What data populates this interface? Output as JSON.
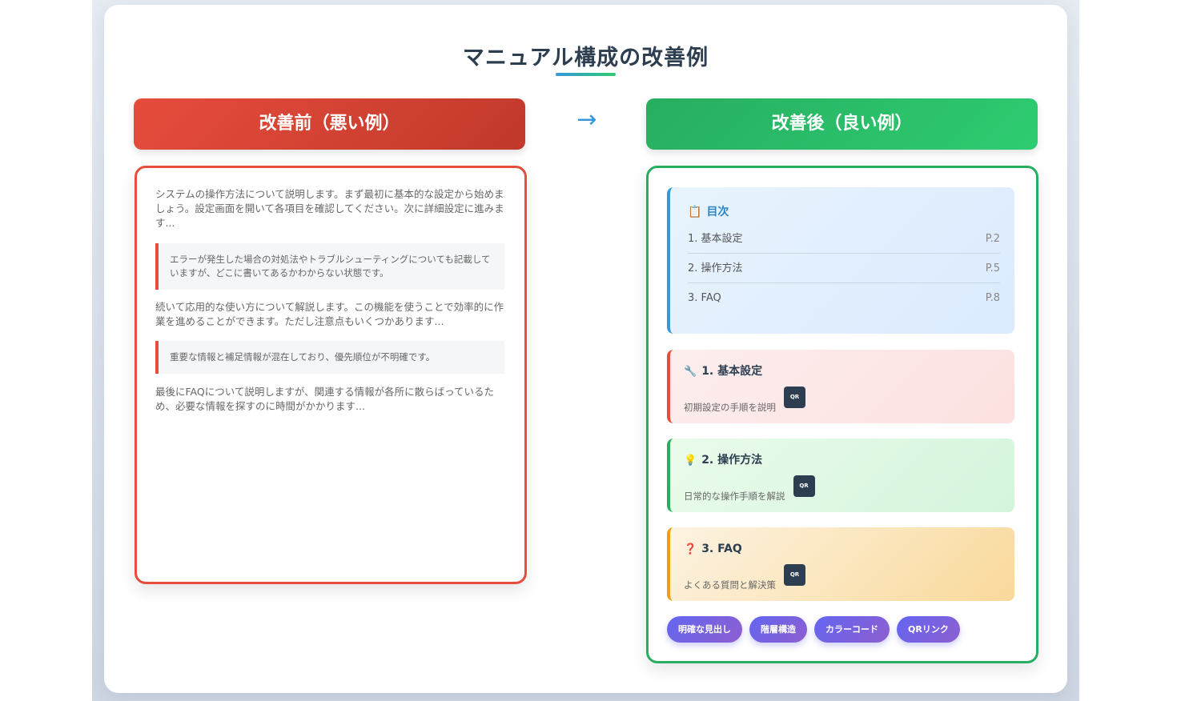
{
  "title": "マニュアル構成の改善例",
  "arrow": "→",
  "before": {
    "header": "改善前（悪い例）",
    "para1": "システムの操作方法について説明します。まず最初に基本的な設定から始めましょう。設定画面を開いて各項目を確認してください。次に詳細設定に進みます...",
    "note1": "エラーが発生した場合の対処法やトラブルシューティングについても記載していますが、どこに書いてあるかわからない状態です。",
    "para2": "続いて応用的な使い方について解説します。この機能を使うことで効率的に作業を進めることができます。ただし注意点もいくつかあります...",
    "note2": "重要な情報と補足情報が混在しており、優先順位が不明確です。",
    "para3": "最後にFAQについて説明しますが、関連する情報が各所に散らばっているため、必要な情報を探すのに時間がかかります..."
  },
  "after": {
    "header": "改善後（良い例）",
    "toc": {
      "icon": "📋",
      "title": "目次",
      "items": [
        {
          "label": "1. 基本設定",
          "page": "P.2"
        },
        {
          "label": "2. 操作方法",
          "page": "P.5"
        },
        {
          "label": "3. FAQ",
          "page": "P.8"
        }
      ]
    },
    "sections": [
      {
        "icon": "🔧",
        "title": "1. 基本設定",
        "desc": "初期設定の手順を説明",
        "qr": "QR"
      },
      {
        "icon": "💡",
        "title": "2. 操作方法",
        "desc": "日常的な操作手順を解説",
        "qr": "QR"
      },
      {
        "icon": "❓",
        "title": "3. FAQ",
        "desc": "よくある質問と解決策",
        "qr": "QR"
      }
    ],
    "tags": [
      "明確な見出し",
      "階層構造",
      "カラーコード",
      "QRリンク"
    ]
  },
  "colors": {
    "bad": "#e74c3c",
    "good": "#27ae60",
    "toc_accent": "#3498db",
    "faq_accent": "#f39c12",
    "tag": "#6366f1"
  }
}
